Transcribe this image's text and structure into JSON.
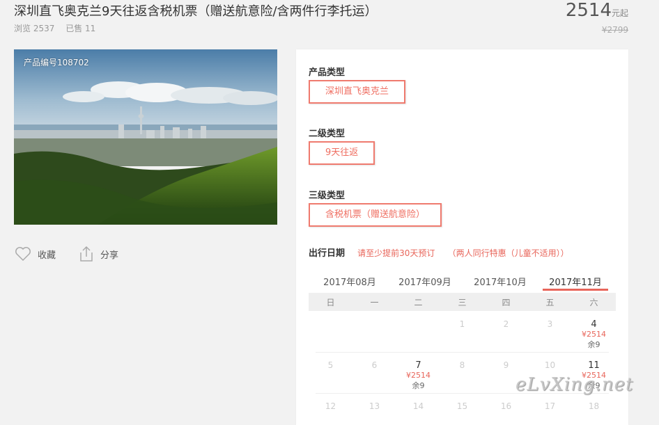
{
  "product": {
    "title": "深圳直飞奥克兰9天往返含税机票（赠送航意险/含两件行李托运）",
    "views": "浏览 2537",
    "sold": "已售 11",
    "price": "2514",
    "price_unit": "元起",
    "original_price": "¥2799",
    "code": "产品编号108702"
  },
  "actions": {
    "favorite": "收藏",
    "share": "分享"
  },
  "options": {
    "type_label": "产品类型",
    "type_value": "深圳直飞奥克兰",
    "level2_label": "二级类型",
    "level2_value": "9天往返",
    "level3_label": "三级类型",
    "level3_value": "含税机票（赠送航意险）"
  },
  "travel_date": {
    "label": "出行日期",
    "note1": "请至少提前30天预订",
    "note2": "（两人同行特惠（儿童不适用））"
  },
  "calendar": {
    "months": [
      "2017年08月",
      "2017年09月",
      "2017年10月",
      "2017年11月"
    ],
    "active_month": "2017年11月",
    "weekdays": [
      "日",
      "一",
      "二",
      "三",
      "四",
      "五",
      "六"
    ],
    "weeks": [
      [
        {
          "d": ""
        },
        {
          "d": ""
        },
        {
          "d": ""
        },
        {
          "d": "1"
        },
        {
          "d": "2"
        },
        {
          "d": "3"
        },
        {
          "d": "4",
          "price": "¥2514",
          "stock": "余9"
        }
      ],
      [
        {
          "d": "5"
        },
        {
          "d": "6"
        },
        {
          "d": "7",
          "price": "¥2514",
          "stock": "余9"
        },
        {
          "d": "8"
        },
        {
          "d": "9"
        },
        {
          "d": "10"
        },
        {
          "d": "11",
          "price": "¥2514",
          "stock": "余9"
        }
      ],
      [
        {
          "d": "12"
        },
        {
          "d": "13"
        },
        {
          "d": "14"
        },
        {
          "d": "15"
        },
        {
          "d": "16"
        },
        {
          "d": "17"
        },
        {
          "d": "18"
        }
      ]
    ]
  },
  "watermark": "eLvXing.net",
  "colors": {
    "accent": "#e8655a",
    "border": "#ef7a6e"
  }
}
